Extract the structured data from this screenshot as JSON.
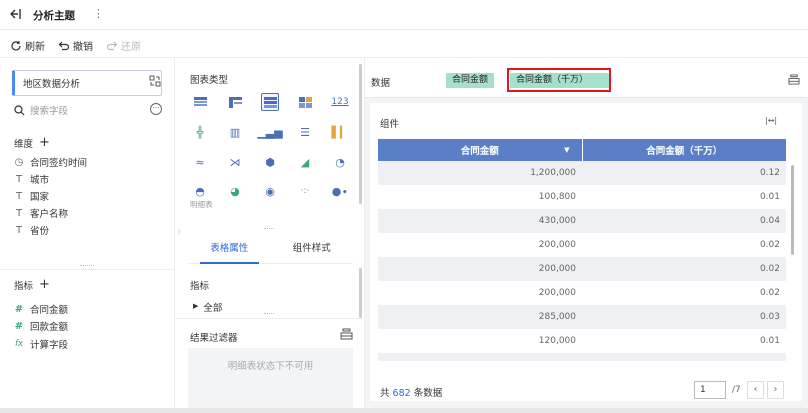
{
  "header": {
    "title": "分析主题"
  },
  "toolbar": {
    "refresh": "刷新",
    "undo": "撤销",
    "redo": "还原"
  },
  "left": {
    "dataset": "地区数据分析",
    "search_placeholder": "搜索字段",
    "dimension_label": "维度",
    "dimensions": [
      {
        "icon": "clock-icon",
        "label": "合同签约时间"
      },
      {
        "icon": "text-field-icon",
        "label": "城市"
      },
      {
        "icon": "text-field-icon",
        "label": "国家"
      },
      {
        "icon": "text-field-icon",
        "label": "客户名称"
      },
      {
        "icon": "text-field-icon",
        "label": "省份"
      }
    ],
    "measure_label": "指标",
    "measures": [
      {
        "icon": "number-field-icon",
        "label": "合同金额"
      },
      {
        "icon": "number-field-icon",
        "label": "回款金额"
      },
      {
        "icon": "formula-field-icon",
        "label": "计算字段"
      }
    ]
  },
  "middle": {
    "chart_type_label": "图表类型",
    "chart_caption": "明细表",
    "tabs": [
      "表格属性",
      "组件样式"
    ],
    "measure_label": "指标",
    "all_label": "全部",
    "filter_label": "结果过滤器",
    "filter_empty": "明细表状态下不可用"
  },
  "right": {
    "data_label": "数据",
    "tags": [
      "合同金额",
      "合同金额（千万）"
    ],
    "component_label": "组件",
    "table": {
      "headers": [
        "合同金额",
        "合同金额（千万）"
      ],
      "rows": [
        [
          "1,200,000",
          "0.12"
        ],
        [
          "100,800",
          "0.01"
        ],
        [
          "430,000",
          "0.04"
        ],
        [
          "200,000",
          "0.02"
        ],
        [
          "200,000",
          "0.02"
        ],
        [
          "200,000",
          "0.02"
        ],
        [
          "285,000",
          "0.03"
        ],
        [
          "120,000",
          "0.01"
        ]
      ]
    },
    "footer_prefix": "共",
    "footer_count": "682",
    "footer_suffix": "条数据",
    "page_current": "1",
    "page_total": "/7"
  },
  "colors": {
    "accent": "#2c6bd6",
    "header_blue": "#5b7fc7",
    "tag_green": "#a6e0cc",
    "highlight_red": "#e0191a"
  }
}
